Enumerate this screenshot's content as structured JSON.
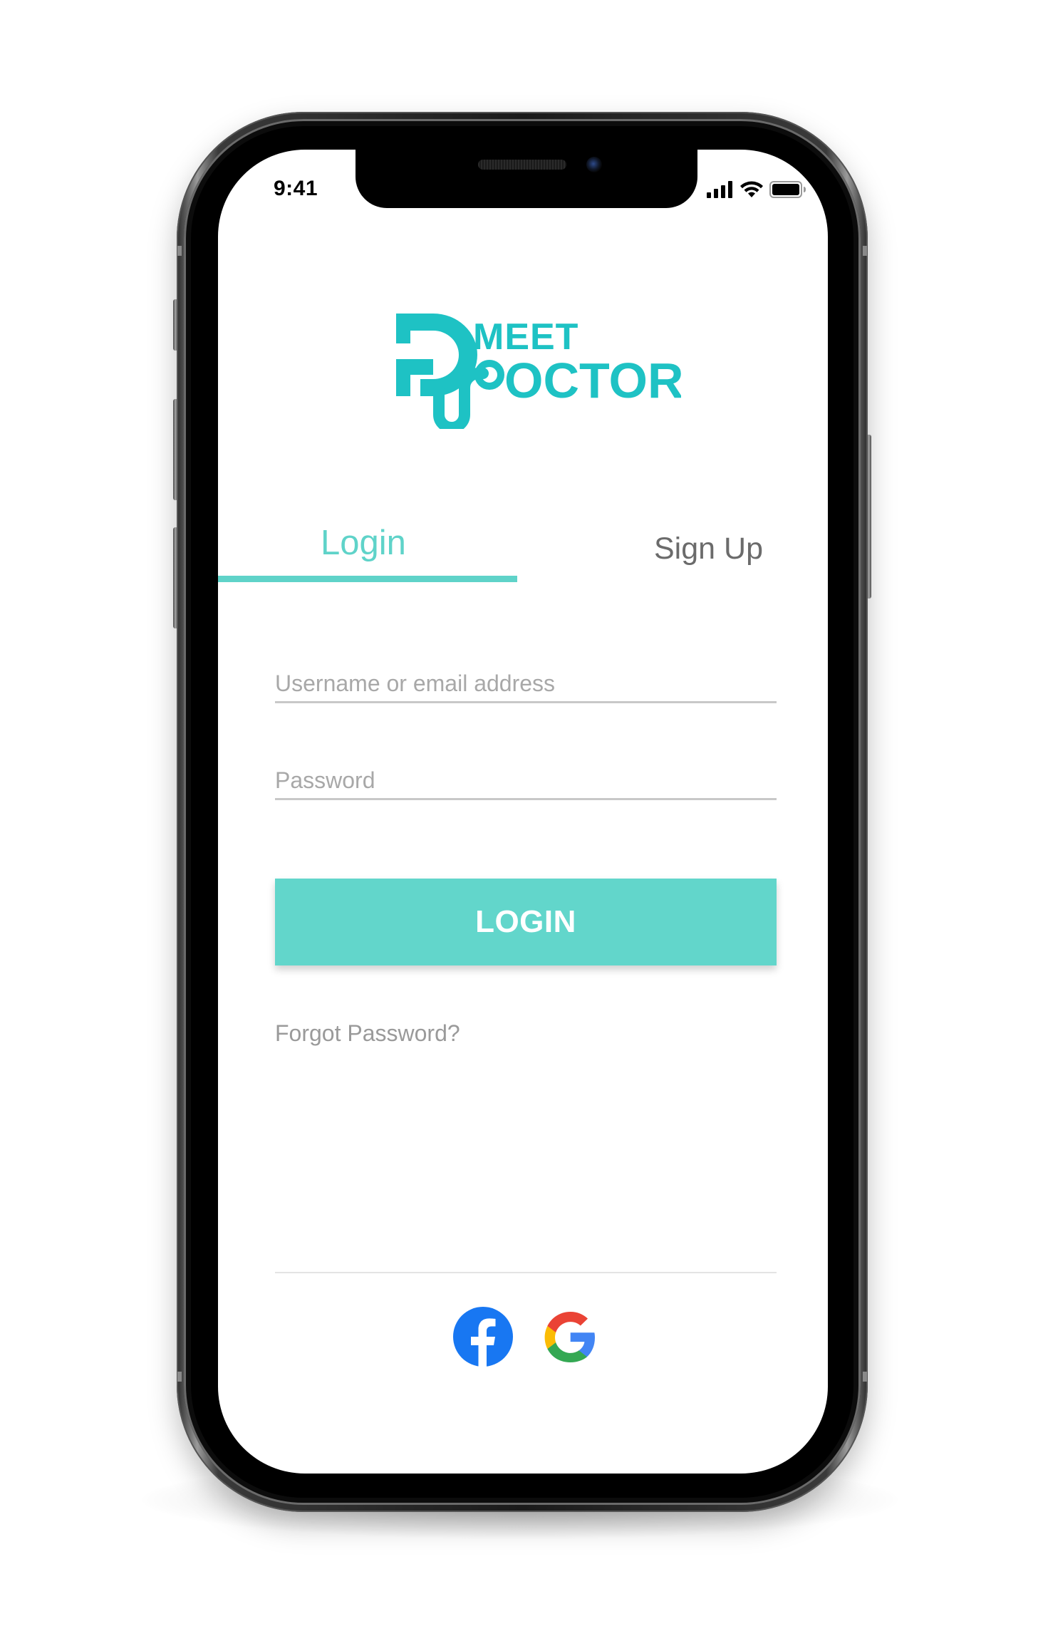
{
  "status_bar": {
    "time": "9:41",
    "icons": [
      "cellular-signal-icon",
      "wifi-icon",
      "battery-icon"
    ]
  },
  "logo": {
    "line1": "MEET",
    "line2": "OCTOR",
    "icon": "stethoscope-d-icon",
    "color": "#1ec2c4"
  },
  "tabs": [
    {
      "label": "Login",
      "active": true
    },
    {
      "label": "Sign Up",
      "active": false
    }
  ],
  "form": {
    "username": {
      "value": "",
      "placeholder": "Username or email address"
    },
    "password": {
      "value": "",
      "placeholder": "Password"
    },
    "submit_label": "LOGIN",
    "forgot_label": "Forgot Password?"
  },
  "social": [
    {
      "name": "facebook",
      "icon": "facebook-icon",
      "color": "#1877f2"
    },
    {
      "name": "google",
      "icon": "google-icon"
    }
  ],
  "colors": {
    "accent": "#62d6cb",
    "tab_active": "#5fd3c9",
    "tab_inactive": "#6b6b6b"
  }
}
